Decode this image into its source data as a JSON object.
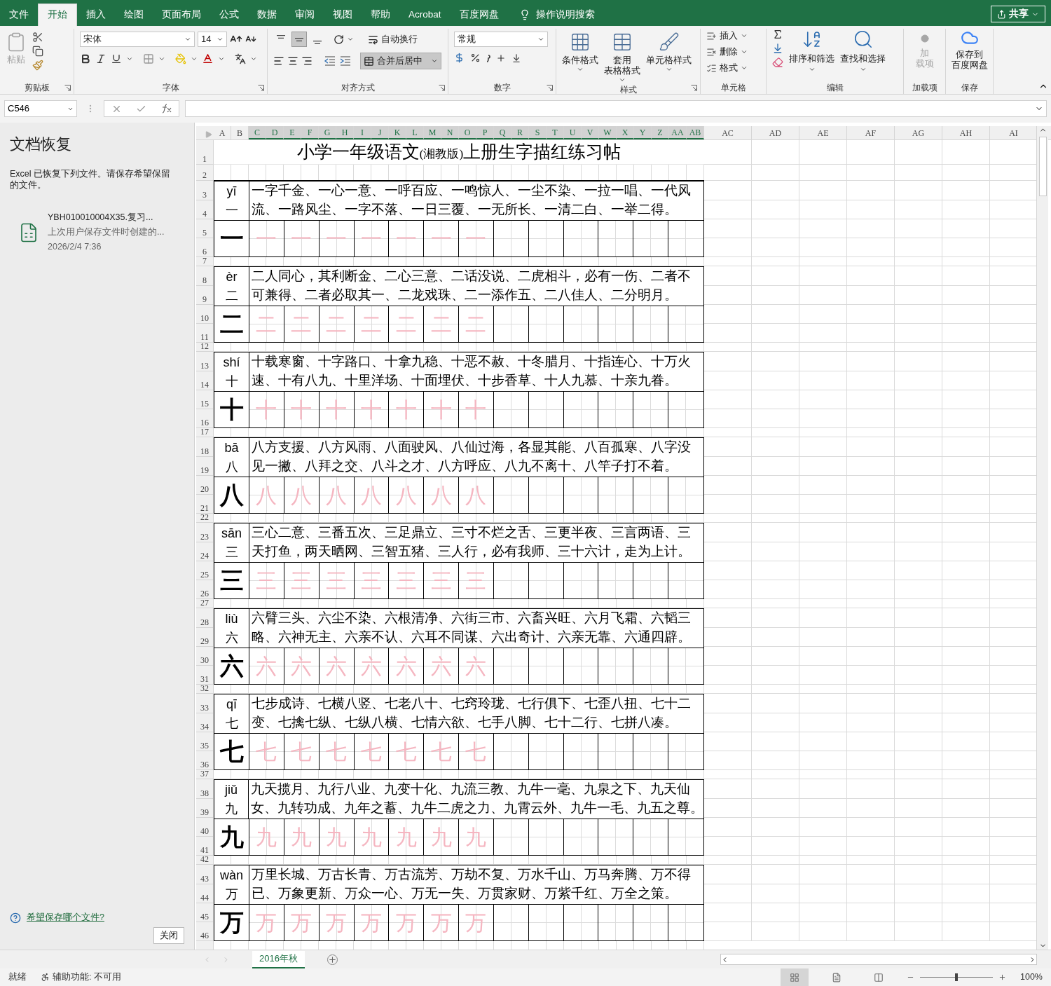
{
  "menu_tabs": [
    {
      "label": "文件",
      "selected": false
    },
    {
      "label": "开始",
      "selected": true
    },
    {
      "label": "插入",
      "selected": false
    },
    {
      "label": "绘图",
      "selected": false
    },
    {
      "label": "页面布局",
      "selected": false
    },
    {
      "label": "公式",
      "selected": false
    },
    {
      "label": "数据",
      "selected": false
    },
    {
      "label": "审阅",
      "selected": false
    },
    {
      "label": "视图",
      "selected": false
    },
    {
      "label": "帮助",
      "selected": false
    },
    {
      "label": "Acrobat",
      "selected": false
    },
    {
      "label": "百度网盘",
      "selected": false
    }
  ],
  "tell_me": "操作说明搜索",
  "share": "共享",
  "ribbon": {
    "clipboard": {
      "paste": "粘贴",
      "label": "剪贴板"
    },
    "font": {
      "name": "宋体",
      "size": "14",
      "label": "字体"
    },
    "alignment": {
      "vertical": [
        {
          "selected": false
        },
        {
          "selected": true
        },
        {
          "selected": false
        }
      ],
      "wrap": "自动换行",
      "merge": {
        "label": "合并后居中",
        "on": true
      },
      "label": "对齐方式"
    },
    "number": {
      "format": "常规",
      "label": "数字"
    },
    "styles": {
      "buttons": [
        {
          "lines": [
            "条件格式"
          ]
        },
        {
          "lines": [
            "套用",
            "表格格式"
          ]
        },
        {
          "lines": [
            "单元格样式"
          ]
        }
      ],
      "label": "样式"
    },
    "cells": {
      "buttons": [
        "插入",
        "删除",
        "格式"
      ],
      "label": "单元格"
    },
    "editing": {
      "buttons": [
        "排序和筛选",
        "查找和选择"
      ],
      "label": "编辑"
    },
    "addins": {
      "lines": [
        "加",
        "载项"
      ],
      "disabled": true,
      "label": "加载项"
    },
    "save": {
      "lines": [
        "保存到",
        "百度网盘"
      ],
      "label": "保存"
    }
  },
  "name_box": "C546",
  "recovery": {
    "title": "文档恢复",
    "message": "Excel 已恢复下列文件。请保存希望保留的文件。",
    "file": {
      "name": "YBH010010004X35.复习...",
      "note": "上次用户保存文件时创建的...",
      "time": "2026/2/4 7:36"
    },
    "help_link": "希望保存哪个文件?",
    "close": "关闭"
  },
  "sheet": {
    "title": {
      "before": "小学一年级语文",
      "edition": "(湘教版)",
      "after": "上册生字描红练习帖"
    },
    "columns": [
      {
        "label": "A",
        "selected": false
      },
      {
        "label": "B",
        "selected": false
      },
      {
        "label": "C",
        "selected": true
      },
      {
        "label": "D",
        "selected": true
      },
      {
        "label": "E",
        "selected": true
      },
      {
        "label": "F",
        "selected": true
      },
      {
        "label": "G",
        "selected": true
      },
      {
        "label": "H",
        "selected": true
      },
      {
        "label": "I",
        "selected": true
      },
      {
        "label": "J",
        "selected": true
      },
      {
        "label": "K",
        "selected": true
      },
      {
        "label": "L",
        "selected": true
      },
      {
        "label": "M",
        "selected": true
      },
      {
        "label": "N",
        "selected": true
      },
      {
        "label": "O",
        "selected": true
      },
      {
        "label": "P",
        "selected": true
      },
      {
        "label": "Q",
        "selected": true
      },
      {
        "label": "R",
        "selected": true
      },
      {
        "label": "S",
        "selected": true
      },
      {
        "label": "T",
        "selected": true
      },
      {
        "label": "U",
        "selected": true
      },
      {
        "label": "V",
        "selected": true
      },
      {
        "label": "W",
        "selected": true
      },
      {
        "label": "X",
        "selected": true
      },
      {
        "label": "Y",
        "selected": true
      },
      {
        "label": "Z",
        "selected": true
      },
      {
        "label": "AA",
        "selected": true
      },
      {
        "label": "AB",
        "selected": true
      },
      {
        "label": "AC",
        "selected": false
      },
      {
        "label": "AD",
        "selected": false
      },
      {
        "label": "AE",
        "selected": false
      },
      {
        "label": "AF",
        "selected": false
      },
      {
        "label": "AG",
        "selected": false
      },
      {
        "label": "AH",
        "selected": false
      },
      {
        "label": "AI",
        "selected": false
      }
    ],
    "rows": [
      "1",
      "2",
      "3",
      "4",
      "5",
      "6",
      "7",
      "8",
      "9",
      "10",
      "11",
      "12",
      "13",
      "14",
      "15",
      "16",
      "17",
      "18",
      "19",
      "20",
      "21",
      "22",
      "23",
      "24",
      "25",
      "26",
      "27",
      "28",
      "29",
      "30",
      "31",
      "32",
      "33",
      "34",
      "35",
      "36",
      "37",
      "38",
      "39",
      "40",
      "41",
      "42",
      "43",
      "44",
      "45",
      "46"
    ],
    "entries": [
      {
        "pinyin": "yī",
        "character": "一",
        "big_character": "一",
        "phrases": [
          "一字千金、一心一意、一呼百应、一鸣惊人、一尘不染、一拉一唱、一代风",
          "流、一路风尘、一字不落、一日三覆、一无所长、一清二白、一举二得。"
        ],
        "traces": [
          "一",
          "一",
          "一",
          "一",
          "一",
          "一",
          "一"
        ]
      },
      {
        "pinyin": "èr",
        "character": "二",
        "big_character": "二",
        "phrases": [
          "二人同心，其利断金、二心三意、二话没说、二虎相斗，必有一伤、二者不",
          "可兼得、二者必取其一、二龙戏珠、二一添作五、二八佳人、二分明月。"
        ],
        "traces": [
          "二",
          "二",
          "二",
          "二",
          "二",
          "二",
          "二"
        ]
      },
      {
        "pinyin": "shí",
        "character": "十",
        "big_character": "十",
        "phrases": [
          "十载寒窗、十字路口、十拿九稳、十恶不赦、十冬腊月、十指连心、十万火",
          "速、十有八九、十里洋场、十面埋伏、十步香草、十人九慕、十亲九眷。"
        ],
        "traces": [
          "十",
          "十",
          "十",
          "十",
          "十",
          "十",
          "十"
        ]
      },
      {
        "pinyin": "bā",
        "character": "八",
        "big_character": "八",
        "phrases": [
          "八方支援、八方风雨、八面驶风、八仙过海，各显其能、八百孤寒、八字没",
          "见一撇、八拜之交、八斗之才、八方呼应、八九不离十、八竿子打不着。"
        ],
        "traces": [
          "八",
          "八",
          "八",
          "八",
          "八",
          "八",
          "八"
        ]
      },
      {
        "pinyin": "sān",
        "character": "三",
        "big_character": "三",
        "phrases": [
          "三心二意、三番五次、三足鼎立、三寸不烂之舌、三更半夜、三言两语、三",
          "天打鱼，两天晒网、三智五猪、三人行，必有我师、三十六计，走为上计。"
        ],
        "traces": [
          "三",
          "三",
          "三",
          "三",
          "三",
          "三",
          "三"
        ]
      },
      {
        "pinyin": "liù",
        "character": "六",
        "big_character": "六",
        "phrases": [
          "六臂三头、六尘不染、六根清净、六街三市、六畜兴旺、六月飞霜、六韬三",
          "略、六神无主、六亲不认、六耳不同谋、六出奇计、六亲无靠、六通四辟。"
        ],
        "traces": [
          "六",
          "六",
          "六",
          "六",
          "六",
          "六",
          "六"
        ]
      },
      {
        "pinyin": "qī",
        "character": "七",
        "big_character": "七",
        "phrases": [
          "七步成诗、七横八竖、七老八十、七窍玲珑、七行俱下、七歪八扭、七十二",
          "变、七擒七纵、七纵八横、七情六欲、七手八脚、七十二行、七拼八凑。"
        ],
        "traces": [
          "七",
          "七",
          "七",
          "七",
          "七",
          "七",
          "七"
        ]
      },
      {
        "pinyin": "jiǔ",
        "character": "九",
        "big_character": "九",
        "phrases": [
          "九天揽月、九行八业、九变十化、九流三教、九牛一毫、九泉之下、九天仙",
          "女、九转功成、九年之蓄、九牛二虎之力、九霄云外、九牛一毛、九五之尊。"
        ],
        "traces": [
          "九",
          "九",
          "九",
          "九",
          "九",
          "九",
          "九"
        ]
      },
      {
        "pinyin": "wàn",
        "character": "万",
        "big_character": "万",
        "phrases": [
          "万里长城、万古长青、万古流芳、万劫不复、万水千山、万马奔腾、万不得",
          "已、万象更新、万众一心、万无一失、万贯家财、万紫千红、万全之策。"
        ],
        "traces": [
          "万",
          "万",
          "万",
          "万",
          "万",
          "万",
          "万"
        ]
      }
    ]
  },
  "sheet_tabs": [
    {
      "label": "2016年秋",
      "selected": true
    }
  ],
  "status": {
    "ready": "就绪",
    "accessibility": "辅助功能: 不可用",
    "views": [
      {
        "selected": true
      },
      {
        "selected": false
      },
      {
        "selected": false
      }
    ],
    "zoom_slider": {
      "level": 0.5
    },
    "zoom": "100%"
  }
}
